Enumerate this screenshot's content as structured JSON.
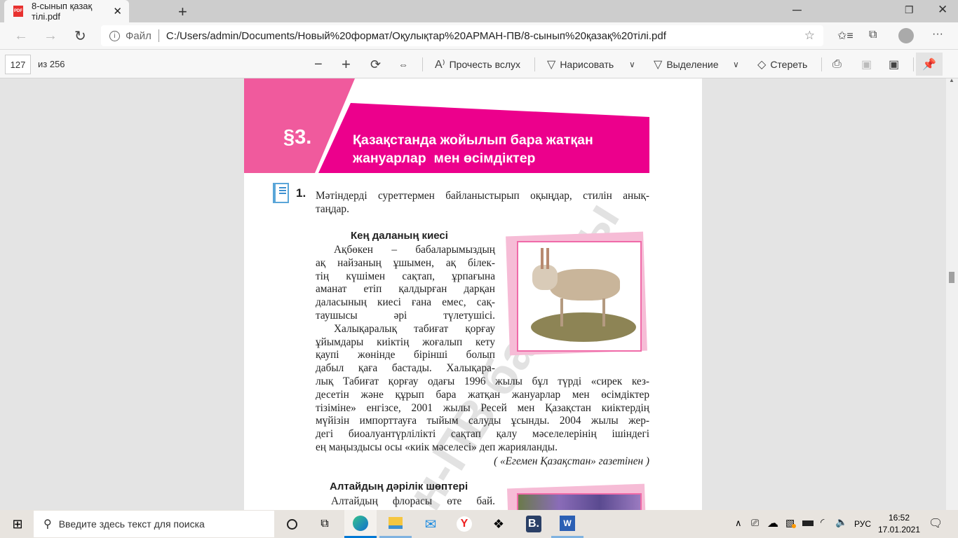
{
  "browser": {
    "tab_title": "8-сынып қазақ тілі.pdf",
    "address_prefix": "Файл",
    "url": "C:/Users/admin/Documents/Новый%20формат/Оқулықтар%20АРМАН-ПВ/8-сынып%20қазақ%20тілі.pdf"
  },
  "pdf_toolbar": {
    "page_number": "127",
    "page_total": "из 256",
    "read_aloud": "Прочесть вслух",
    "draw": "Нарисовать",
    "highlight": "Выделение",
    "erase": "Стереть"
  },
  "document": {
    "section_number": "§3.",
    "section_title_line1": "Қазақстанда жойылып бара жатқан",
    "section_title_line2": "жануарлар  мен өсімдіктер",
    "task_number": "1.",
    "task_lines": [
      "Мәтіндерді суреттермен байланыстырып оқыңдар, стилін анық-",
      "таңдар."
    ],
    "heading1": "Кең даланың киесі",
    "text1_narrow": [
      "Ақбөкен – бабаларымыздың",
      "ақ найзаның ұшымен, ақ білек-",
      "тің күшімен сақтап, ұрпағына",
      "аманат етіп қалдырған дарқан",
      "даласының киесі ғана емес, сақ-",
      "таушысы әрі түлетушісі.",
      "Халықаралық табиғат қорғау",
      "ұйымдары киіктің жоғалып кету",
      "қаупі жөнінде бірінші болып",
      "дабыл қаға бастады. Халықара-"
    ],
    "text1_wide": [
      "лық Табиғат қорғау одағы 1996 жылы бұл түрді «сирек кез-",
      "десетін және құрып бара жатқан жануарлар мен өсімдіктер",
      "тізіміне» енгізсе, 2001 жылы Ресей мен Қазақстан киіктердің",
      "мүйізін импорттауға тыйым салуды ұсынды. 2004 жылы жер-",
      "дегі биоалуантүрлілікті сақтап қалу мәселелерінің ішіндегі",
      "ең маңыздысы осы «киік мәселесі» деп жарияланды."
    ],
    "source": "( «Егемен Қазақстан» газетінен )",
    "heading2": "Алтайдың дәрілік шөптері",
    "text2_first": "Алтайдың флорасы өте бай.",
    "watermark": "н-ПВ баспасы"
  },
  "taskbar": {
    "search_placeholder": "Введите здесь текст для поиска",
    "language": "РУС",
    "time": "16:52",
    "date": "17.01.2021"
  },
  "colors": {
    "pink_light": "#f05a9d",
    "pink_main": "#ec008c",
    "accent_blue": "#0078d4"
  }
}
